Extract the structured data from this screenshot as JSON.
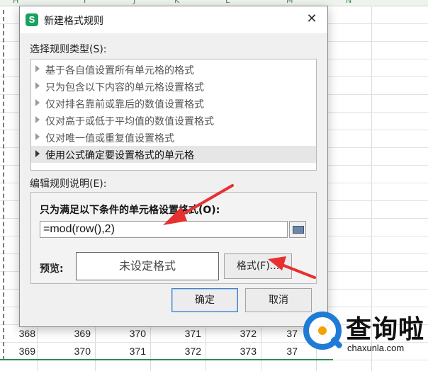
{
  "sheet": {
    "col_headers": [
      "H",
      "I",
      "J",
      "K",
      "L",
      "M",
      "N"
    ],
    "rows": [
      [
        "368",
        "369",
        "370",
        "371",
        "372",
        "37"
      ],
      [
        "369",
        "370",
        "371",
        "372",
        "373",
        "37"
      ]
    ]
  },
  "dialog": {
    "title": "新建格式规则",
    "close_glyph": "✕",
    "select_type_label": "选择规则类型(S):",
    "rule_types": [
      "基于各自值设置所有单元格的格式",
      "只为包含以下内容的单元格设置格式",
      "仅对排名靠前或靠后的数值设置格式",
      "仅对高于或低于平均值的数值设置格式",
      "仅对唯一值或重复值设置格式",
      "使用公式确定要设置格式的单元格"
    ],
    "selected_rule_index": 5,
    "edit_description_label": "编辑规则说明(E):",
    "condition_label": "只为满足以下条件的单元格设置格式(O):",
    "formula_value": "=mod(row(),2)",
    "preview_label": "预览:",
    "preview_text": "未设定格式",
    "format_button": "格式(F)...",
    "ok_button": "确定",
    "cancel_button": "取消"
  },
  "logo": {
    "text": "查询啦",
    "url": "chaxunla.com"
  },
  "colors": {
    "annotation_arrow": "#e83030",
    "logo_blue": "#1f7bd6",
    "logo_orange": "#f2a300",
    "app_icon_green": "#19a15f"
  },
  "icons": {
    "app": "wps-s-icon",
    "range_picker": "collapse-dialog-icon",
    "close": "close-icon"
  }
}
